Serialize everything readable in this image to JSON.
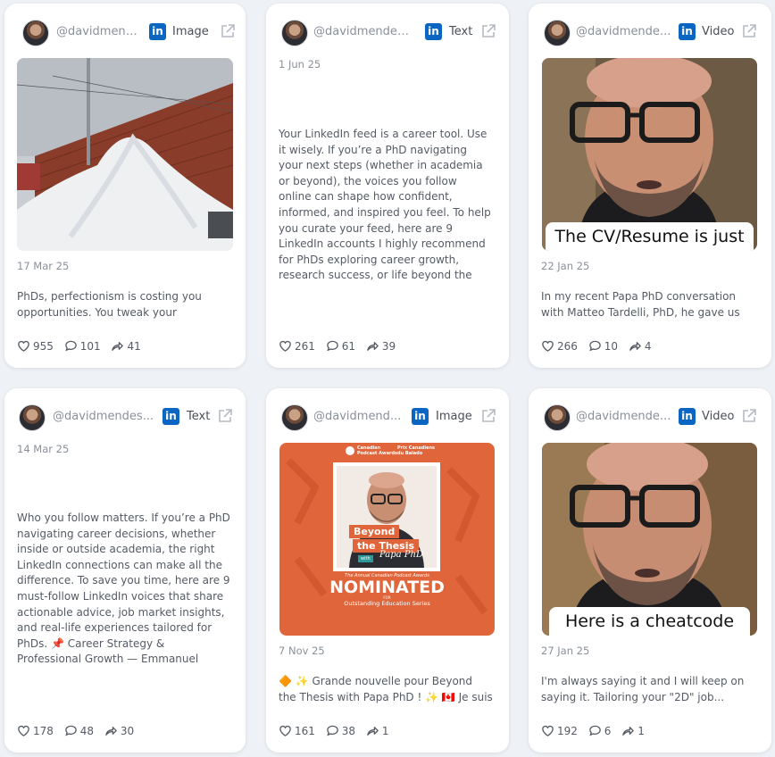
{
  "cards": [
    {
      "handle": "@davidmendes...",
      "type_label": "Image",
      "date": "17 Mar 25",
      "text": "PhDs, perfectionism is costing you opportunities. You tweak your research...",
      "likes": "955",
      "comments": "101",
      "shares": "41"
    },
    {
      "handle": "@davidmendes...",
      "type_label": "Text",
      "date": "1 Jun 25",
      "text": "Your LinkedIn feed is a career tool. Use it wisely. If you’re a PhD navigating your next steps (whether in academia or beyond), the voices you follow online can shape how confident, informed, and inspired you feel. To help you curate your feed, here are 9 LinkedIn accounts I highly recommend for PhDs exploring career growth, research success, or life beyond the academy: 📌 Academic...",
      "likes": "261",
      "comments": "61",
      "shares": "39"
    },
    {
      "handle": "@davidmende...",
      "type_label": "Video",
      "date": "22 Jan 25",
      "caption": "The CV/Resume is just",
      "text": "In my recent Papa PhD conversation with Matteo Tardelli, PhD, he gave us a...",
      "likes": "266",
      "comments": "10",
      "shares": "4"
    },
    {
      "handle": "@davidmendes...",
      "type_label": "Text",
      "date": "14 Mar 25",
      "text": "Who you follow matters. If you’re a PhD navigating career decisions, whether inside or outside academia, the right LinkedIn connections can make all the difference. To save you time, here are 9 must-follow LinkedIn voices that share actionable advice, job market insights, and real-life experiences tailored for PhDs. 📌 Career Strategy & Professional Growth — Emmanuel Tsekleves: on...",
      "likes": "178",
      "comments": "48",
      "shares": "30"
    },
    {
      "handle": "@davidmend...",
      "type_label": "Image",
      "date": "7 Nov 25",
      "poster": {
        "top_left": "Canadian Podcast Awards",
        "top_right": "Prix Canadiens du Balado",
        "title_line1": "Beyond",
        "title_line2": "the Thesis",
        "with": "with",
        "signature": "Papa PhD",
        "awards_line": "The Annual Canadian Podcast Awards",
        "nominated": "NOMINATED",
        "for": "FOR",
        "category": "Outstanding Education Series"
      },
      "text": "🔶 ✨ Grande nouvelle pour Beyond the Thesis with Papa PhD ! ✨ 🇨🇦 Je suis très...",
      "likes": "161",
      "comments": "38",
      "shares": "1"
    },
    {
      "handle": "@davidmende...",
      "type_label": "Video",
      "date": "27 Jan 25",
      "caption": "Here is a cheatcode",
      "text": "I'm always saying it and I will keep on saying it. Tailoring your \"2D\" job...",
      "likes": "192",
      "comments": "6",
      "shares": "1"
    }
  ],
  "colors": {
    "linkedin": "#0a66c2",
    "poster_orange": "#e0653a",
    "background": "#eef1f5"
  }
}
